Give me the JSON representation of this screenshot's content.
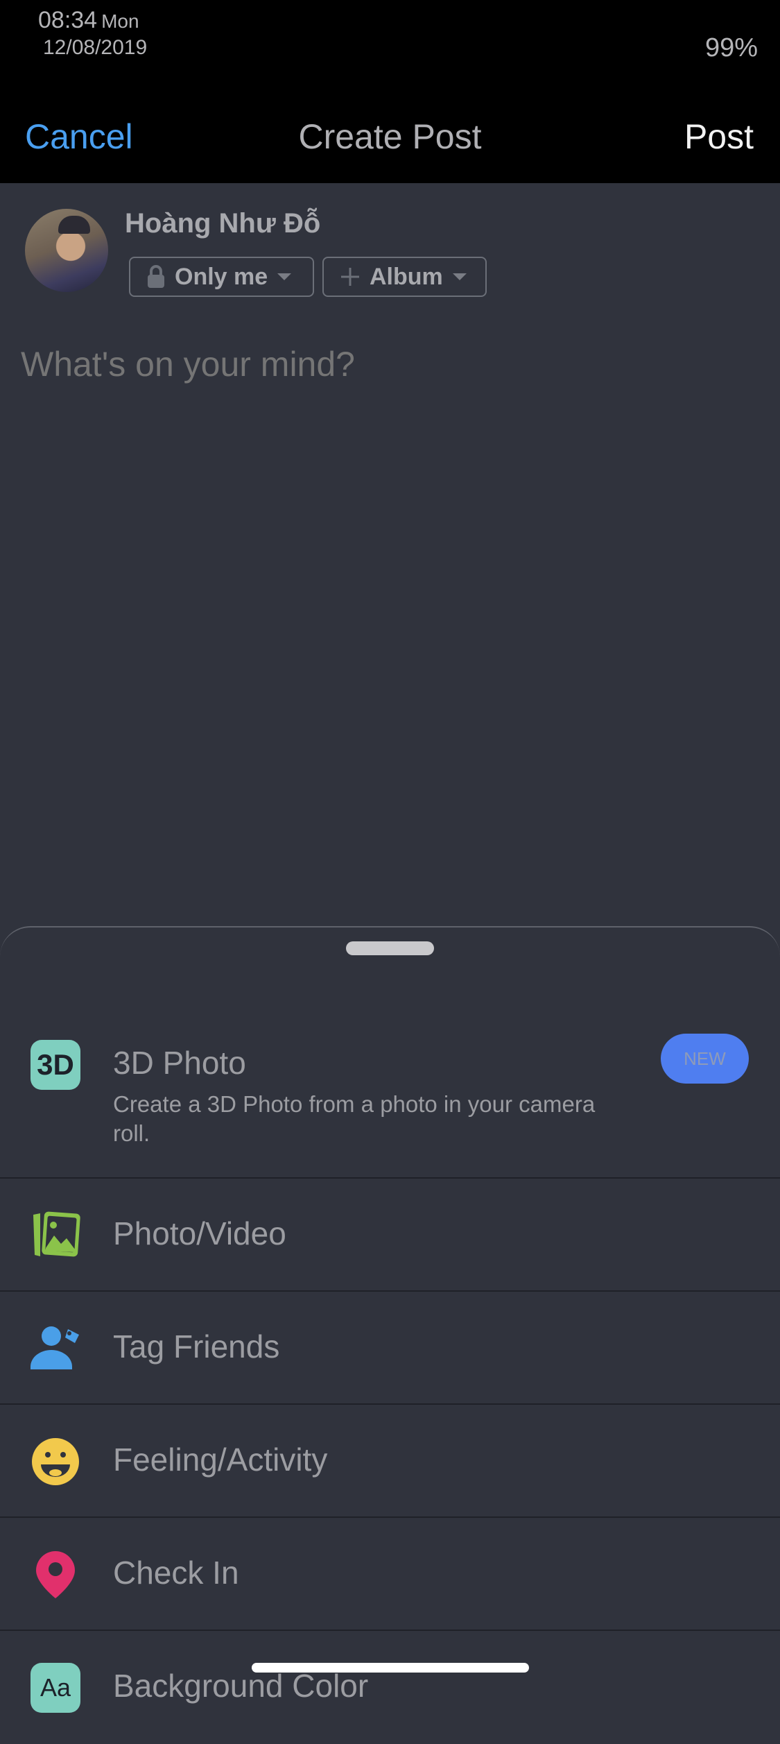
{
  "status_bar": {
    "time": "08:34",
    "day": "Mon",
    "date": "12/08/2019",
    "battery": "99%"
  },
  "nav": {
    "cancel_label": "Cancel",
    "title": "Create Post",
    "post_label": "Post"
  },
  "author": {
    "name": "Hoàng Như Đỗ",
    "privacy": {
      "icon": "lock-icon",
      "label": "Only me"
    },
    "album": {
      "icon": "plus-icon",
      "label": "Album"
    }
  },
  "composer": {
    "placeholder": "What's on your mind?",
    "value": ""
  },
  "sheet": {
    "items": [
      {
        "icon": "3d-photo-icon",
        "label": "3D Photo",
        "description": "Create a 3D Photo from a photo in your camera roll.",
        "badge": "NEW",
        "icon_text": "3D",
        "color": "#7fcfbf"
      },
      {
        "icon": "photo-video-icon",
        "label": "Photo/Video",
        "color": "#8bc34a"
      },
      {
        "icon": "tag-friends-icon",
        "label": "Tag Friends",
        "color": "#4a9fe8"
      },
      {
        "icon": "feeling-icon",
        "label": "Feeling/Activity",
        "color": "#f2c94c"
      },
      {
        "icon": "check-in-icon",
        "label": "Check In",
        "color": "#e1306c"
      },
      {
        "icon": "background-color-icon",
        "label": "Background Color",
        "icon_text": "Aa",
        "color": "#7fcfbf"
      }
    ],
    "badge_color": "#4f7ef0"
  },
  "colors": {
    "accent": "#4a9ff0",
    "background": "#30333d",
    "topbar": "#000000"
  }
}
